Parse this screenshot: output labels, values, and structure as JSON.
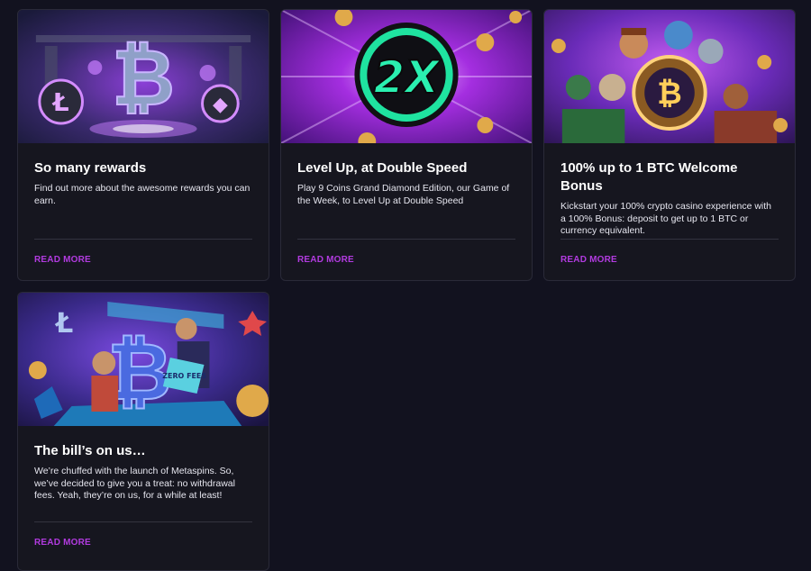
{
  "cards": [
    {
      "title": "So many rewards",
      "description": "Find out more about the awesome rewards you can earn.",
      "cta": "READ MORE",
      "image_icon": "bitcoin-vault-image"
    },
    {
      "title": "Level Up, at Double Speed",
      "description": "Play 9 Coins Grand Diamond Edition, our Game of the Week, to Level Up at Double Speed",
      "cta": "READ MORE",
      "image_icon": "2x-badge-image",
      "badge_text": "2X"
    },
    {
      "title": "100% up to 1 BTC Welcome Bonus",
      "description": "Kickstart your 100% crypto casino experience with a 100% Bonus: deposit to get up to 1 BTC or currency equivalent.",
      "cta": "READ MORE",
      "image_icon": "characters-bitcoin-image"
    },
    {
      "title": "The bill’s on us…",
      "description": "We’re chuffed with the launch of Metaspins. So, we’ve decided to give you a treat: no withdrawal fees. Yeah, they’re on us, for a while at least!",
      "cta": "READ MORE",
      "image_icon": "zero-fees-image",
      "tag_text": "ZERO FEES"
    }
  ],
  "colors": {
    "background": "#12121f",
    "card": "#16161f",
    "accent": "#b23be0"
  }
}
